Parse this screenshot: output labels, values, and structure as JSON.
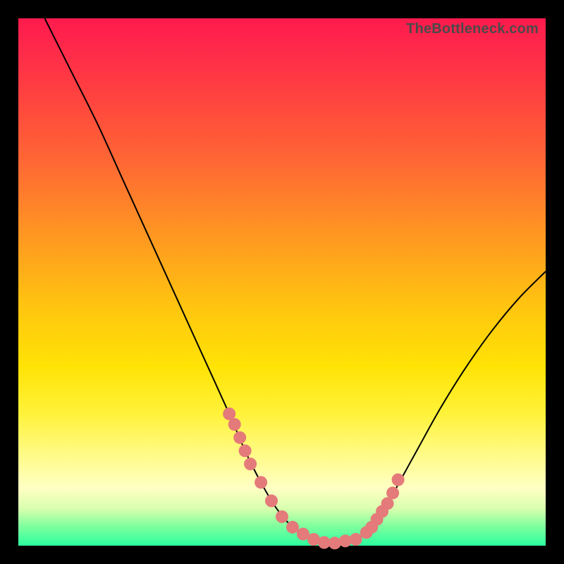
{
  "watermark": "TheBottleneck.com",
  "colors": {
    "frame": "#000000",
    "gradient_top": "#ff1a4d",
    "gradient_bottom": "#2bff9e",
    "curve": "#000000",
    "dots": "#e47a7a"
  },
  "chart_data": {
    "type": "line",
    "title": "",
    "xlabel": "",
    "ylabel": "",
    "xlim": [
      0,
      100
    ],
    "ylim": [
      0,
      100
    ],
    "curve": {
      "x": [
        5,
        10,
        15,
        20,
        25,
        30,
        35,
        40,
        43,
        46,
        49,
        52,
        55,
        58,
        61,
        64,
        67,
        70,
        75,
        80,
        85,
        90,
        95,
        100
      ],
      "y": [
        100,
        90,
        80,
        69,
        58,
        47,
        36,
        25,
        18,
        12,
        7,
        3.5,
        1.5,
        0.6,
        0.5,
        1.2,
        3.5,
        8,
        17,
        26,
        34,
        41,
        47,
        52
      ]
    },
    "highlight_dots": {
      "x": [
        40,
        41,
        42,
        43,
        44,
        46,
        48,
        50,
        52,
        54,
        56,
        58,
        60,
        62,
        64,
        66,
        67,
        68,
        69,
        70,
        71,
        72
      ],
      "y": [
        25,
        23,
        20.5,
        18,
        15.5,
        12,
        8.5,
        5.5,
        3.5,
        2.2,
        1.2,
        0.6,
        0.5,
        0.9,
        1.2,
        2.5,
        3.5,
        5,
        6.5,
        8,
        10,
        12.5
      ]
    }
  }
}
